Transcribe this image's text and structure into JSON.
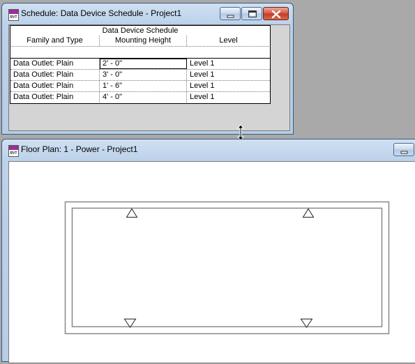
{
  "schedule_window": {
    "title": "Schedule: Data Device Schedule - Project1",
    "app_icon_text": "RVT"
  },
  "schedule": {
    "title": "Data Device Schedule",
    "columns": [
      "Family and Type",
      "Mounting Height",
      "Level"
    ],
    "rows": [
      {
        "family_type": "Data Outlet: Plain",
        "mounting_height": "2' - 0\"",
        "level": "Level 1"
      },
      {
        "family_type": "Data Outlet: Plain",
        "mounting_height": "3' - 0\"",
        "level": "Level 1"
      },
      {
        "family_type": "Data Outlet: Plain",
        "mounting_height": "1' - 6\"",
        "level": "Level 1"
      },
      {
        "family_type": "Data Outlet: Plain",
        "mounting_height": "4' - 0\"",
        "level": "Level 1"
      }
    ]
  },
  "floorplan_window": {
    "title": "Floor Plan: 1 - Power - Project1",
    "app_icon_text": "RVT"
  },
  "icons": {
    "minimize": "minimize-icon",
    "maximize": "maximize-icon",
    "close": "close-icon",
    "resize_cursor": "resize-vertical-cursor-icon",
    "data_outlet": "data-outlet-triangle-icon"
  },
  "colors": {
    "close_button": "#c33a22",
    "titlebar": "#bcd2ea"
  }
}
